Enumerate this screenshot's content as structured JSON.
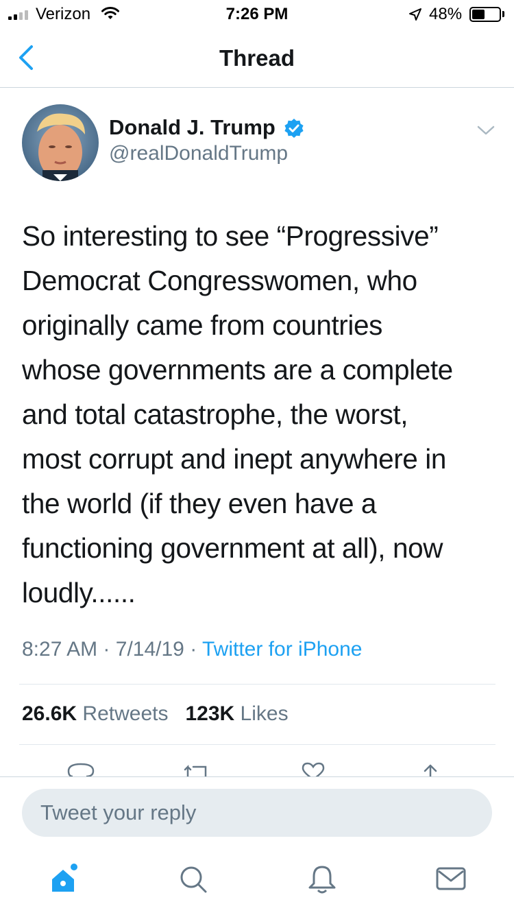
{
  "status_bar": {
    "carrier": "Verizon",
    "time": "7:26 PM",
    "battery_percent": "48%",
    "battery_level": 0.48
  },
  "nav": {
    "title": "Thread",
    "back_icon": "chevron-left-icon"
  },
  "tweet": {
    "author_name": "Donald J. Trump",
    "author_handle": "@realDonaldTrump",
    "verified": true,
    "text_lines": [
      "So interesting to see “Progressive”",
      "Democrat Congresswomen, who",
      "originally came from countries",
      "whose governments are a complete",
      "and total catastrophe, the worst,",
      "most corrupt and inept anywhere in",
      "the world (if they even have a",
      "functioning government at all), now",
      "loudly......"
    ],
    "time": "8:27 AM",
    "date": "7/14/19",
    "separator": "·",
    "source": "Twitter for iPhone",
    "retweet_count": "26.6K",
    "retweet_label": "Retweets",
    "like_count": "123K",
    "like_label": "Likes"
  },
  "actions": [
    "reply-icon",
    "retweet-icon",
    "like-icon",
    "share-icon"
  ],
  "reply": {
    "placeholder": "Tweet your reply"
  },
  "tab_bar": {
    "items": [
      "home-icon",
      "search-icon",
      "notifications-icon",
      "messages-icon"
    ],
    "active": "home-icon"
  },
  "colors": {
    "accent": "#1da1f2",
    "text": "#14171a",
    "secondary_text": "#657786",
    "divider": "#e1e8ed",
    "input_bg": "#e6ecf0"
  }
}
